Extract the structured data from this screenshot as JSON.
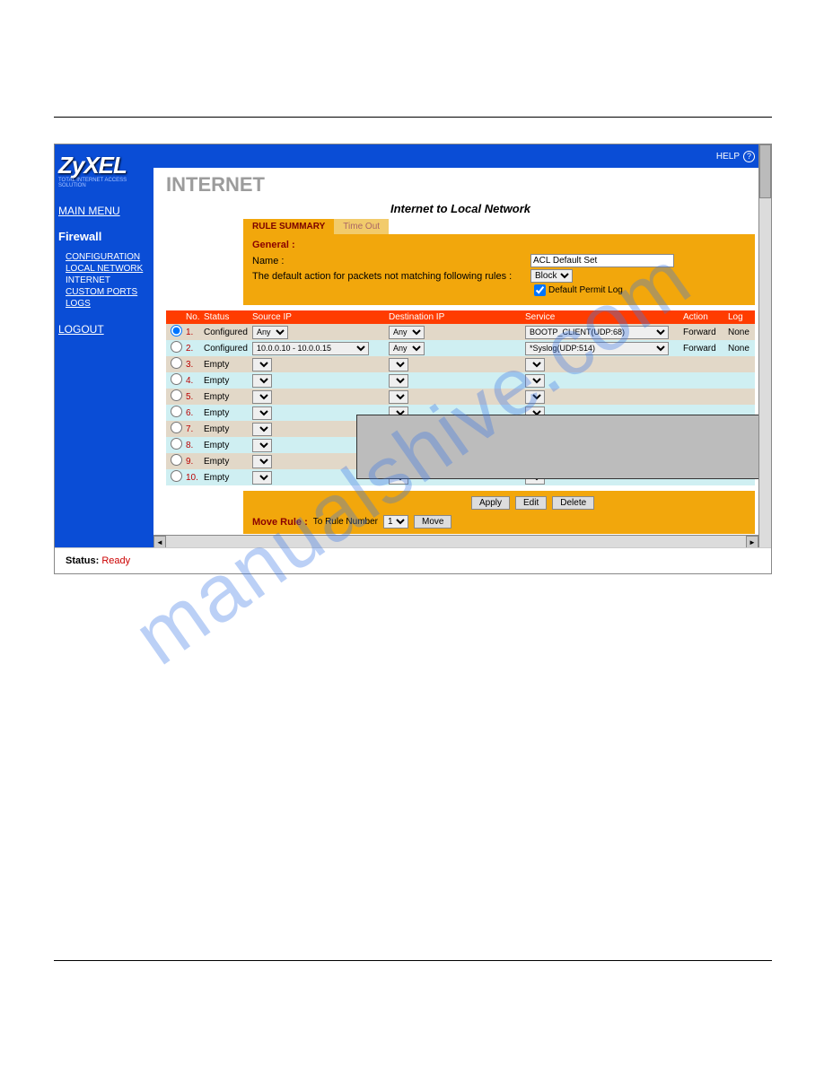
{
  "watermark": "manualshive.com",
  "logo": "ZyXEL",
  "logo_sub": "TOTAL INTERNET ACCESS SOLUTION",
  "topbar": {
    "help": "HELP",
    "help_icon": "?"
  },
  "sidebar": {
    "main_menu": "MAIN MENU",
    "firewall": "Firewall",
    "links": [
      "CONFIGURATION",
      "LOCAL NETWORK",
      "INTERNET",
      "CUSTOM PORTS",
      "LOGS"
    ],
    "logout": "LOGOUT"
  },
  "page": {
    "title": "INTERNET",
    "subtitle": "Internet to Local Network"
  },
  "tabs": {
    "active": "RULE SUMMARY",
    "inactive": "Time Out"
  },
  "general": {
    "heading": "General :",
    "name_label": "Name :",
    "name_value": "ACL Default Set",
    "default_action_label": "The default action for packets not matching following rules :",
    "default_action_value": "Block",
    "checkbox_label": "Default Permit Log",
    "checkbox_checked": true
  },
  "columns": {
    "no": "No.",
    "status": "Status",
    "src": "Source IP",
    "dst": "Destination IP",
    "svc": "Service",
    "action": "Action",
    "log": "Log"
  },
  "rows": [
    {
      "n": "1.",
      "status": "Configured",
      "src": "Any",
      "dst": "Any",
      "svc": "BOOTP_CLIENT(UDP:68)",
      "action": "Forward",
      "log": "None",
      "sel": true
    },
    {
      "n": "2.",
      "status": "Configured",
      "src": "10.0.0.10 - 10.0.0.15",
      "dst": "Any",
      "svc": "*Syslog(UDP:514)",
      "action": "Forward",
      "log": "None",
      "sel": false
    },
    {
      "n": "3.",
      "status": "Empty",
      "src": "",
      "dst": "",
      "svc": "",
      "action": "",
      "log": "",
      "sel": false
    },
    {
      "n": "4.",
      "status": "Empty",
      "src": "",
      "dst": "",
      "svc": "",
      "action": "",
      "log": "",
      "sel": false
    },
    {
      "n": "5.",
      "status": "Empty",
      "src": "",
      "dst": "",
      "svc": "",
      "action": "",
      "log": "",
      "sel": false
    },
    {
      "n": "6.",
      "status": "Empty",
      "src": "",
      "dst": "",
      "svc": "",
      "action": "",
      "log": "",
      "sel": false
    },
    {
      "n": "7.",
      "status": "Empty",
      "src": "",
      "dst": "",
      "svc": "",
      "action": "",
      "log": "",
      "sel": false
    },
    {
      "n": "8.",
      "status": "Empty",
      "src": "",
      "dst": "",
      "svc": "",
      "action": "",
      "log": "",
      "sel": false
    },
    {
      "n": "9.",
      "status": "Empty",
      "src": "",
      "dst": "",
      "svc": "",
      "action": "",
      "log": "",
      "sel": false
    },
    {
      "n": "10.",
      "status": "Empty",
      "src": "",
      "dst": "",
      "svc": "",
      "action": "",
      "log": "",
      "sel": false
    }
  ],
  "buttons": {
    "apply": "Apply",
    "edit": "Edit",
    "delete": "Delete",
    "move": "Move"
  },
  "move_rule": {
    "label": "Move Rule :",
    "sub": "To Rule Number",
    "value": "1"
  },
  "status_bar": {
    "label": "Status:",
    "value": "Ready"
  }
}
